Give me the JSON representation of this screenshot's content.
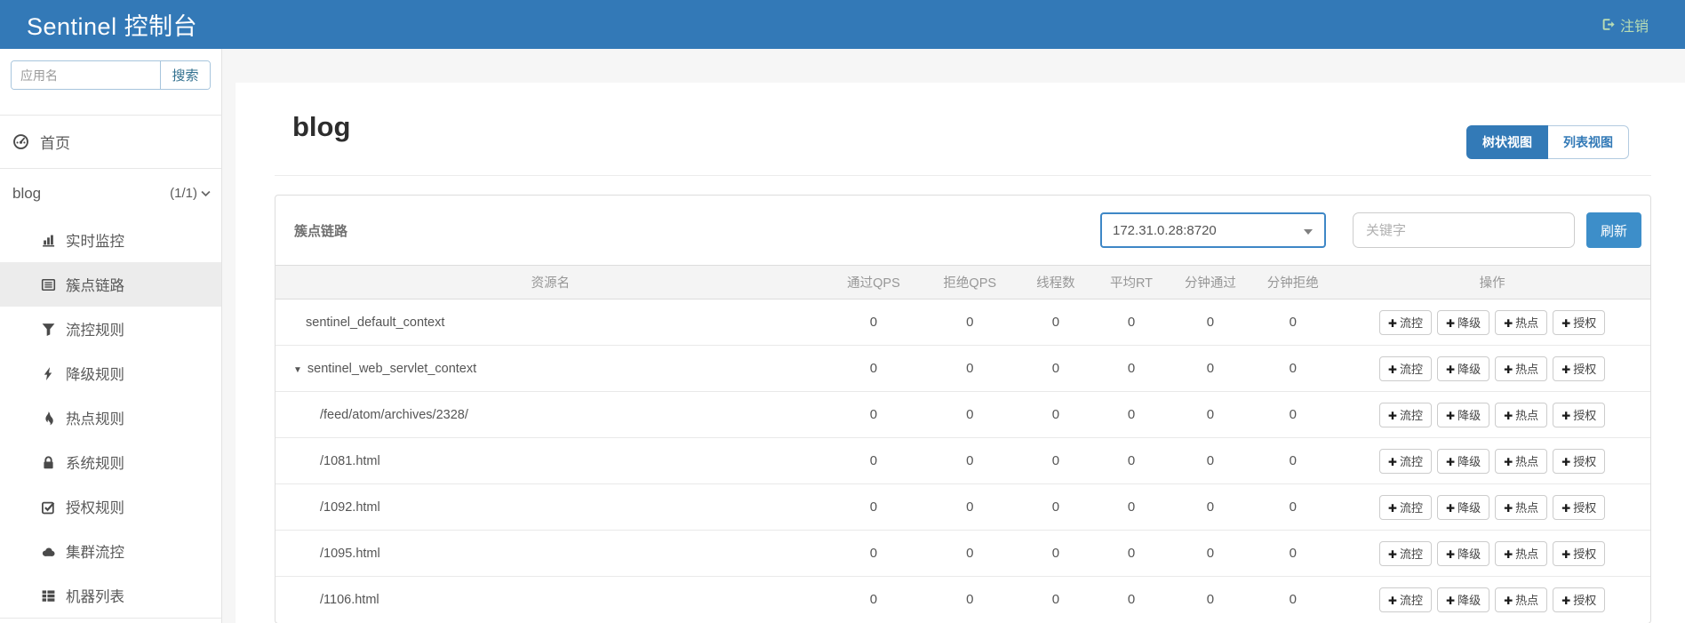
{
  "navbar": {
    "brand": "Sentinel 控制台",
    "logout_label": "注销"
  },
  "sidebar": {
    "search_placeholder": "应用名",
    "search_button": "搜索",
    "home_label": "首页",
    "app_name": "blog",
    "app_count": "(1/1)",
    "items": [
      {
        "label": "实时监控",
        "icon": "chart-bars-icon",
        "active": false
      },
      {
        "label": "簇点链路",
        "icon": "list-alt-icon",
        "active": true
      },
      {
        "label": "流控规则",
        "icon": "filter-icon",
        "active": false
      },
      {
        "label": "降级规则",
        "icon": "bolt-icon",
        "active": false
      },
      {
        "label": "热点规则",
        "icon": "fire-icon",
        "active": false
      },
      {
        "label": "系统规则",
        "icon": "lock-icon",
        "active": false
      },
      {
        "label": "授权规则",
        "icon": "check-square-icon",
        "active": false
      },
      {
        "label": "集群流控",
        "icon": "cloud-icon",
        "active": false
      },
      {
        "label": "机器列表",
        "icon": "th-list-icon",
        "active": false
      }
    ]
  },
  "main": {
    "title": "blog",
    "tree_view_label": "树状视图",
    "list_view_label": "列表视图",
    "active_view": "tree",
    "panel_title": "簇点链路",
    "machine": "172.31.0.28:8720",
    "keyword_placeholder": "关键字",
    "refresh_label": "刷新",
    "table": {
      "columns": [
        "资源名",
        "通过QPS",
        "拒绝QPS",
        "线程数",
        "平均RT",
        "分钟通过",
        "分钟拒绝",
        "操作"
      ],
      "action_labels": [
        "流控",
        "降级",
        "热点",
        "授权"
      ],
      "action_names": [
        "add-flow-rule-button",
        "add-degrade-rule-button",
        "add-param-flow-rule-button",
        "add-authority-rule-button"
      ],
      "rows": [
        {
          "resource": "sentinel_default_context",
          "level": 0,
          "expand": false,
          "values": [
            "0",
            "0",
            "0",
            "0",
            "0",
            "0"
          ]
        },
        {
          "resource": "sentinel_web_servlet_context",
          "level": 0,
          "expand": true,
          "values": [
            "0",
            "0",
            "0",
            "0",
            "0",
            "0"
          ]
        },
        {
          "resource": "/feed/atom/archives/2328/",
          "level": 1,
          "expand": false,
          "values": [
            "0",
            "0",
            "0",
            "0",
            "0",
            "0"
          ]
        },
        {
          "resource": "/1081.html",
          "level": 1,
          "expand": false,
          "values": [
            "0",
            "0",
            "0",
            "0",
            "0",
            "0"
          ]
        },
        {
          "resource": "/1092.html",
          "level": 1,
          "expand": false,
          "values": [
            "0",
            "0",
            "0",
            "0",
            "0",
            "0"
          ]
        },
        {
          "resource": "/1095.html",
          "level": 1,
          "expand": false,
          "values": [
            "0",
            "0",
            "0",
            "0",
            "0",
            "0"
          ]
        },
        {
          "resource": "/1106.html",
          "level": 1,
          "expand": false,
          "values": [
            "0",
            "0",
            "0",
            "0",
            "0",
            "0"
          ]
        }
      ]
    }
  },
  "colors": {
    "navbar_bg": "#3379b7",
    "accent_blue": "#337ab7",
    "refresh_blue": "#3d8ec9",
    "logout_text": "#b9ddb4",
    "active_item_bg": "#ececec",
    "table_header_bg": "#f4f4f4"
  }
}
